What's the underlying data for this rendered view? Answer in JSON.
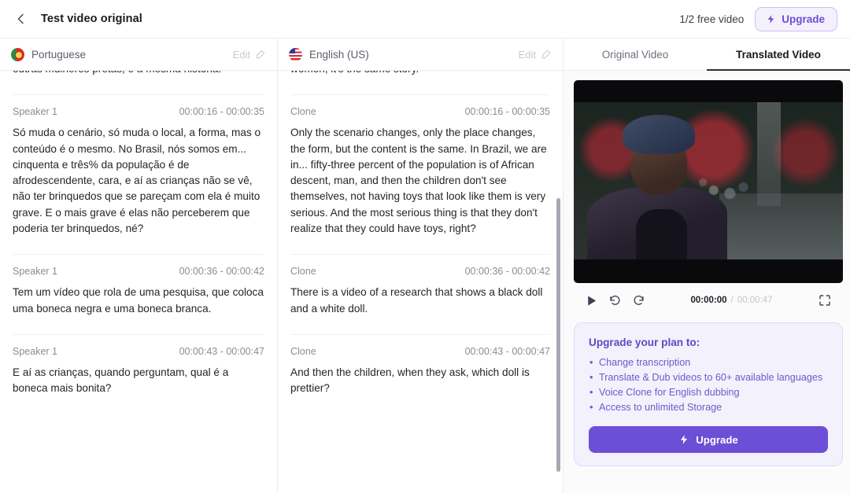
{
  "header": {
    "back_icon": "chevron-left-icon",
    "title": "Test video original",
    "free_video_count": "1/2 free video",
    "upgrade_label": "Upgrade",
    "bolt_icon": "lightning-bolt-icon"
  },
  "columns": [
    {
      "flag_icon": "flag-portugal-icon",
      "language": "Portuguese",
      "edit_label": "Edit",
      "edit_icon": "pencil-square-icon",
      "segments": [
        {
          "speaker": "",
          "time": "",
          "text": "outras mulheres pretas, é a mesma história."
        },
        {
          "speaker": "Speaker 1",
          "time": "00:00:16 - 00:00:35",
          "text": "Só muda o cenário, só muda o local, a forma, mas o conteúdo é o mesmo. No Brasil, nós somos em... cinquenta e três% da população é de afrodescendente, cara, e aí as crianças não se vê, não ter brinquedos que se pareçam com ela é muito grave. E o mais grave é elas não perceberem que poderia ter brinquedos, né?"
        },
        {
          "speaker": "Speaker 1",
          "time": "00:00:36 - 00:00:42",
          "text": "Tem um vídeo que rola de uma pesquisa, que coloca uma boneca negra e uma boneca branca."
        },
        {
          "speaker": "Speaker 1",
          "time": "00:00:43 - 00:00:47",
          "text": "E aí as crianças, quando perguntam, qual é a boneca mais bonita?"
        }
      ]
    },
    {
      "flag_icon": "flag-usa-icon",
      "language": "English (US)",
      "edit_label": "Edit",
      "edit_icon": "pencil-square-icon",
      "segments": [
        {
          "speaker": "",
          "time": "",
          "text": "women, it's the same story."
        },
        {
          "speaker": "Clone",
          "time": "00:00:16 - 00:00:35",
          "text": "Only the scenario changes, only the place changes, the form, but the content is the same. In Brazil, we are in... fifty-three percent of the population is of African descent, man, and then the children don't see themselves, not having toys that look like them is very serious. And the most serious thing is that they don't realize that they could have toys, right?"
        },
        {
          "speaker": "Clone",
          "time": "00:00:36 - 00:00:42",
          "text": "There is a video of a research that shows a black doll and a white doll."
        },
        {
          "speaker": "Clone",
          "time": "00:00:43 - 00:00:47",
          "text": "And then the children, when they ask, which doll is prettier?"
        }
      ]
    }
  ],
  "video_tabs": [
    {
      "label": "Original Video",
      "active": false
    },
    {
      "label": "Translated Video",
      "active": true
    }
  ],
  "player": {
    "play_icon": "play-icon",
    "rewind_icon": "rewind-icon",
    "forward_icon": "forward-icon",
    "fullscreen_icon": "fullscreen-icon",
    "current_time": "00:00:00",
    "separator": "/",
    "total_time": "00:00:47"
  },
  "upsell": {
    "title": "Upgrade your plan to:",
    "items": [
      "Change transcription",
      "Translate & Dub videos to 60+ available languages",
      "Voice Clone for English dubbing",
      "Access to unlimited Storage"
    ],
    "button_label": "Upgrade",
    "bolt_icon": "lightning-bolt-icon"
  },
  "colors": {
    "accent": "#6c4fd6",
    "accent_soft": "#f3f1fb",
    "text": "#24242c",
    "muted": "#8b8b98"
  }
}
